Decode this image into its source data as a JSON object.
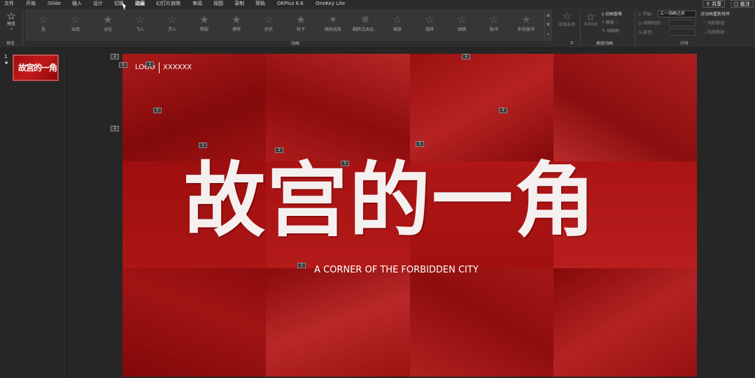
{
  "menu": {
    "items": [
      {
        "label": "文件",
        "active": false
      },
      {
        "label": "开始",
        "active": false
      },
      {
        "label": "iSlide",
        "active": false
      },
      {
        "label": "插入",
        "active": false
      },
      {
        "label": "设计",
        "active": false
      },
      {
        "label": "切换",
        "active": false
      },
      {
        "label": "动画",
        "active": true
      },
      {
        "label": "幻灯片放映",
        "active": false
      },
      {
        "label": "审阅",
        "active": false
      },
      {
        "label": "视图",
        "active": false
      },
      {
        "label": "录制",
        "active": false
      },
      {
        "label": "帮助",
        "active": false
      },
      {
        "label": "OKPlus 6.6",
        "active": false
      },
      {
        "label": "OneKey Lite",
        "active": false
      }
    ],
    "share_label": "共享",
    "comment_label": "批注"
  },
  "ribbon": {
    "preview_label": "预览",
    "preview_group": "预览",
    "animations": [
      "无",
      "出现",
      "淡化",
      "飞入",
      "浮入",
      "劈裂",
      "擦除",
      "形状",
      "轮子",
      "随机线条",
      "翻转式由远...",
      "缩放",
      "旋转",
      "弹跳",
      "脉冲",
      "彩色脉冲"
    ],
    "effect_options_label": "效果选项",
    "animation_group": "动画",
    "add_animation_label": "添加动画",
    "animation_pane_label": "动画窗格",
    "trigger_label": "触发 ~",
    "painter_label": "动画刷",
    "advanced_group": "高级动画",
    "start_label": "开始:",
    "start_value": "上一动画之后",
    "duration_label": "持续时间:",
    "delay_label": "延迟:",
    "timing_group": "计时",
    "reorder_label": "对动画重新排序",
    "move_earlier_label": "向前移动",
    "move_later_label": "向后移动"
  },
  "slides_pane": {
    "slide_number": "1",
    "slide_marker": "★",
    "thumb_text": "故宫的一角"
  },
  "slide": {
    "logo": "LOGO",
    "logo_sub": "XXXXXX",
    "title": "故宫的一角",
    "subtitle": "A CORNER OF THE FORBIDDEN CITY",
    "animation_tag": "1"
  }
}
